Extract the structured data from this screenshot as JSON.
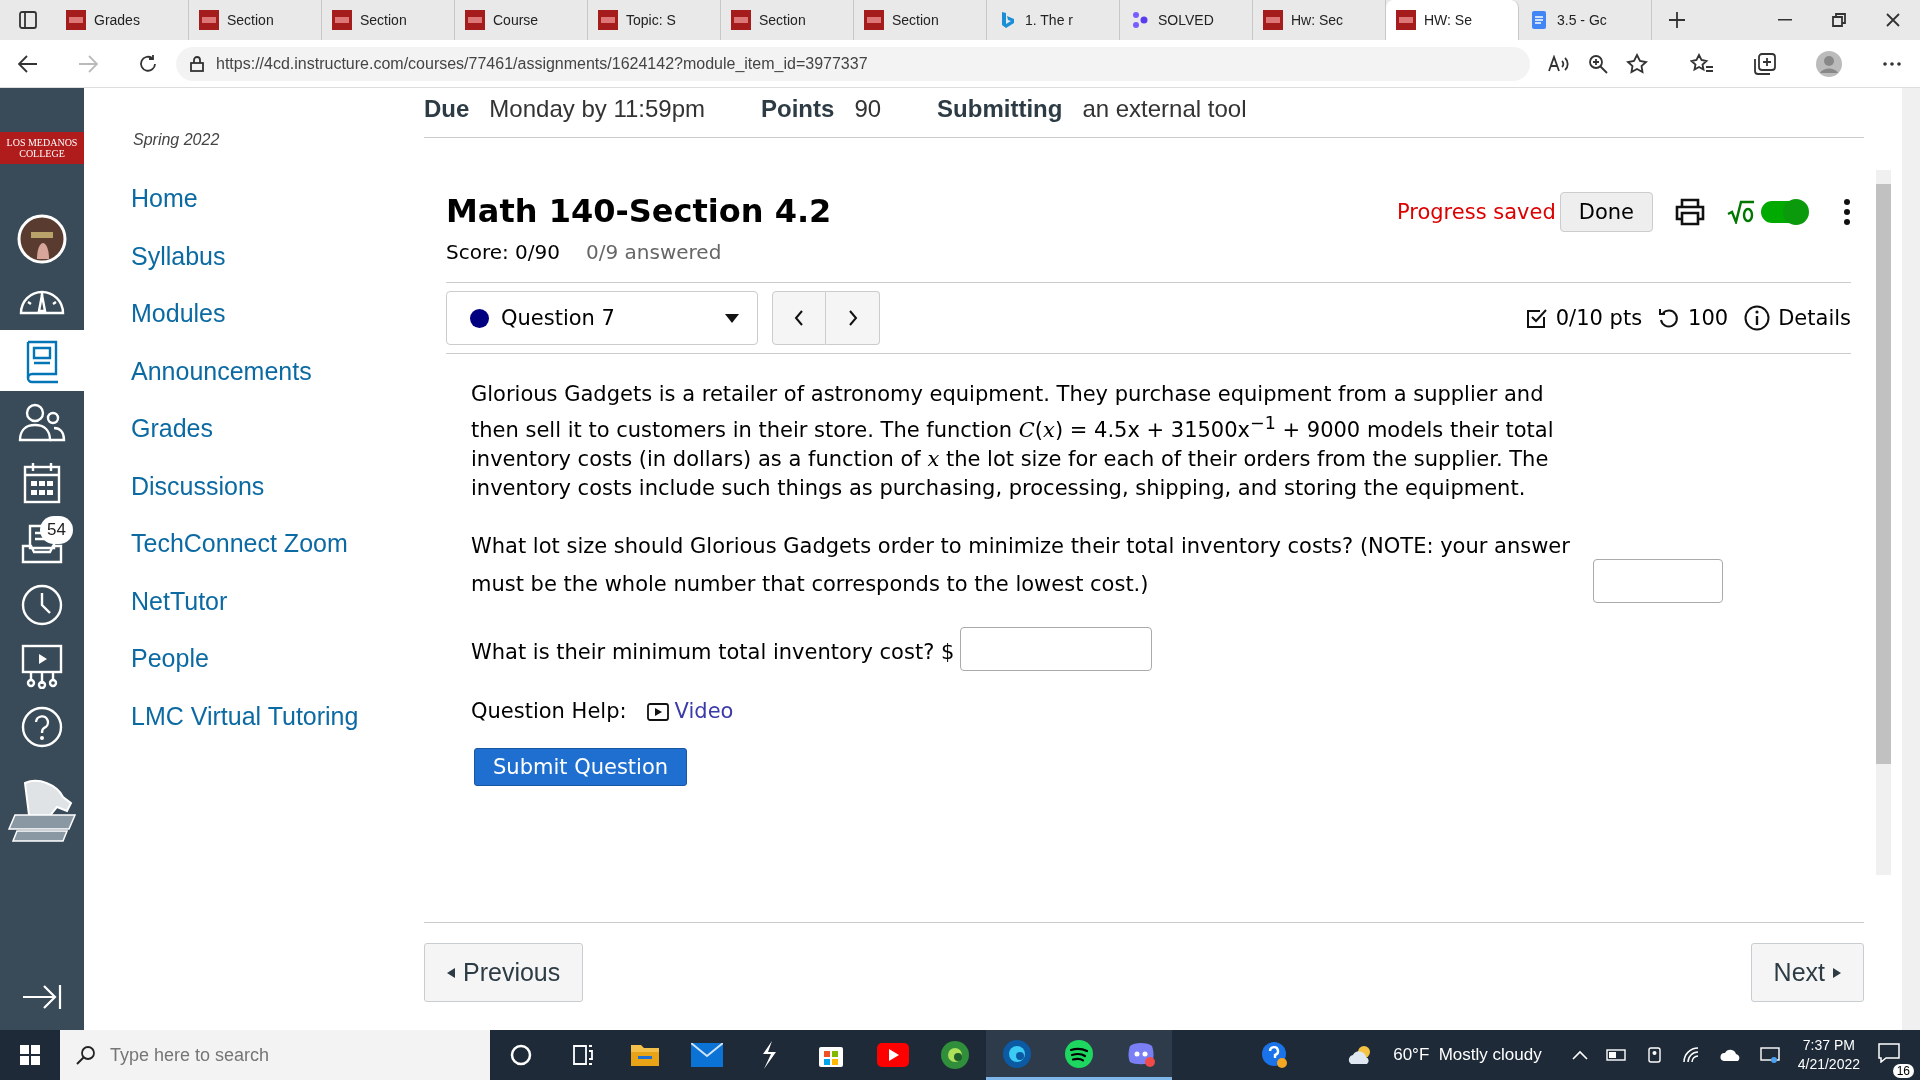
{
  "browser": {
    "tabs": [
      {
        "title": "Grades",
        "kind": "college",
        "selected": false
      },
      {
        "title": "Section",
        "kind": "college",
        "selected": false
      },
      {
        "title": "Section",
        "kind": "college",
        "selected": false
      },
      {
        "title": "Course",
        "kind": "college",
        "selected": false
      },
      {
        "title": "Topic: S",
        "kind": "college",
        "selected": false
      },
      {
        "title": "Section",
        "kind": "college",
        "selected": false
      },
      {
        "title": "Section",
        "kind": "college",
        "selected": false
      },
      {
        "title": "1. The r",
        "kind": "bing",
        "selected": false
      },
      {
        "title": "SOLVED",
        "kind": "solved",
        "selected": false
      },
      {
        "title": "Hw: Sec",
        "kind": "college",
        "selected": false
      },
      {
        "title": "HW: Se",
        "kind": "college",
        "selected": true
      },
      {
        "title": "3.5 - Gc",
        "kind": "doc",
        "selected": false
      }
    ],
    "url": "https://4cd.instructure.com/courses/77461/assignments/1624142?module_item_id=3977337"
  },
  "global_nav": {
    "logo": [
      "LOS MEDANOS",
      "COLLEGE"
    ],
    "items": [
      {
        "kind": "account",
        "selected": false
      },
      {
        "kind": "dashboard",
        "selected": false
      },
      {
        "kind": "courses",
        "selected": true
      },
      {
        "kind": "groups",
        "selected": false
      },
      {
        "kind": "calendar",
        "selected": false
      },
      {
        "kind": "inbox",
        "selected": false,
        "badge": "54"
      },
      {
        "kind": "history",
        "selected": false
      },
      {
        "kind": "studio",
        "selected": false
      },
      {
        "kind": "help",
        "selected": false
      }
    ]
  },
  "course_nav": {
    "term": "Spring 2022",
    "items": [
      "Home",
      "Syllabus",
      "Modules",
      "Announcements",
      "Grades",
      "Discussions",
      "TechConnect Zoom",
      "NetTutor",
      "People",
      "LMC Virtual Tutoring"
    ]
  },
  "assignment_meta": [
    {
      "label": "Due",
      "value": "Monday by 11:59pm"
    },
    {
      "label": "Points",
      "value": "90"
    },
    {
      "label": "Submitting",
      "value": "an external tool"
    }
  ],
  "quiz": {
    "title": "Math 140-Section 4.2",
    "score": "Score: 0/90",
    "answered": "0/9 answered",
    "status": "Progress saved",
    "done": "Done",
    "math_toggle_on": true,
    "question_select": "Question 7",
    "points": "0/10 pts",
    "attempts": "100",
    "details": "Details",
    "intro": "Glorious Gadgets is a retailer of astronomy equipment. They purchase equipment from a supplier and then sell it to customers in their store. The function *C*(*x*) = 4.5x + 31500x$^{−1}$ + 9000 models their total inventory costs (in dollars) as a function of *x* the lot size for each of their orders from the supplier. The inventory costs include such things as purchasing, processing, shipping, and storing the equipment.",
    "prompts": [
      {
        "text": "What lot size should Glorious Gadgets order to minimize their total inventory costs? (NOTE: your answer must be the whole number that corresponds to the lowest cost.)",
        "kind": "short"
      },
      {
        "text": "What is their minimum total inventory cost? $",
        "kind": "wide"
      }
    ],
    "help_label": "Question Help:",
    "help_link": "Video",
    "submit": "Submit Question"
  },
  "pager": {
    "previous": "Previous",
    "next": "Next"
  },
  "taskbar": {
    "search_placeholder": "Type here to search",
    "apps": [
      {
        "kind": "cortana",
        "running": false
      },
      {
        "kind": "taskview",
        "running": false
      },
      {
        "kind": "explorer",
        "running": false
      },
      {
        "kind": "mail",
        "running": false
      },
      {
        "kind": "bolt",
        "running": false
      },
      {
        "kind": "store",
        "running": false
      },
      {
        "kind": "youtube",
        "running": false
      },
      {
        "kind": "edgedev",
        "running": false
      },
      {
        "kind": "edge",
        "running": true
      },
      {
        "kind": "spotify",
        "running": true
      },
      {
        "kind": "discord",
        "running": true
      }
    ],
    "weather": "60°F  Mostly cloudy",
    "time": "7:37 PM",
    "date": "4/21/2022",
    "notifications": "16"
  }
}
